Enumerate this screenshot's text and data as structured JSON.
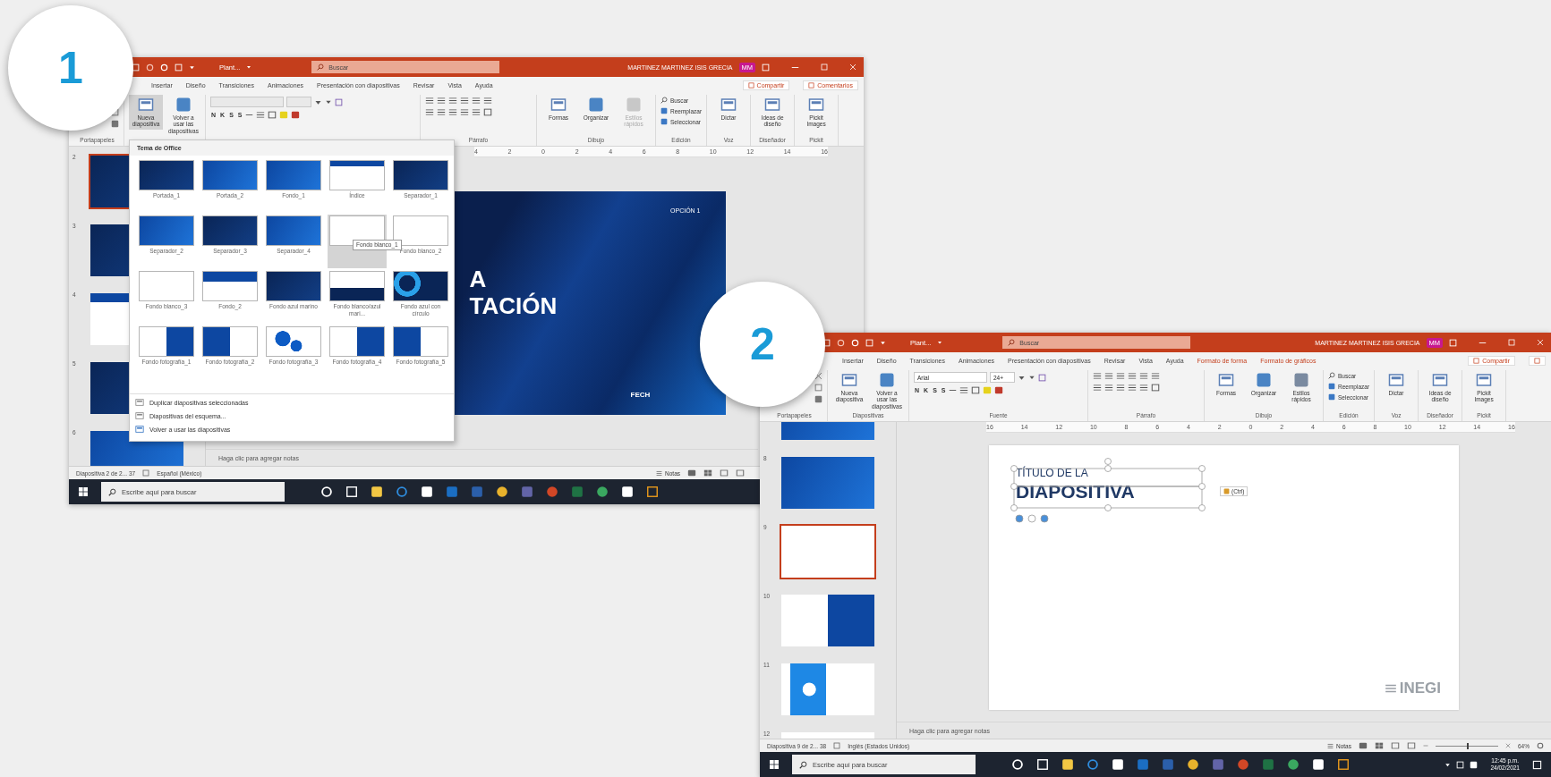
{
  "badges": [
    {
      "label": "1"
    },
    {
      "label": "2"
    }
  ],
  "windows": [
    {
      "title": "Plant...",
      "search_placeholder": "Buscar",
      "user": "MARTINEZ MARTINEZ ISIS GRECIA",
      "avatar": "MM",
      "tabs": [
        {
          "label": "Insertar",
          "kind": "standard"
        },
        {
          "label": "Diseño",
          "kind": "standard"
        },
        {
          "label": "Transiciones",
          "kind": "standard"
        },
        {
          "label": "Animaciones",
          "kind": "standard"
        },
        {
          "label": "Presentación con diapositivas",
          "kind": "standard"
        },
        {
          "label": "Revisar",
          "kind": "standard"
        },
        {
          "label": "Vista",
          "kind": "standard"
        },
        {
          "label": "Ayuda",
          "kind": "standard"
        }
      ],
      "share": "Compartir",
      "comments": "Comentarios",
      "ribbon": [
        {
          "kind": "clipboard",
          "label": "Portapapeles"
        },
        {
          "kind": "large",
          "buttons": [
            {
              "label": "Nueva diapositiva",
              "disabled": false,
              "pressed": true
            },
            {
              "label": "Volver a usar las diapositivas",
              "disabled": false,
              "pressed": false
            }
          ]
        },
        {
          "kind": "font",
          "format_keys": [
            "N",
            "K",
            "S",
            "S"
          ]
        },
        {
          "kind": "paragraph",
          "label": "Párrafo"
        },
        {
          "kind": "large",
          "label": "Dibujo",
          "buttons": [
            {
              "label": "Formas",
              "disabled": false,
              "pressed": false
            },
            {
              "label": "Organizar",
              "disabled": false,
              "pressed": false
            },
            {
              "label": "Estilos rápidos",
              "disabled": true,
              "pressed": false
            }
          ]
        },
        {
          "kind": "list",
          "label": "Edición",
          "buttons": [
            {
              "label": "Buscar"
            },
            {
              "label": "Reemplazar"
            },
            {
              "label": "Seleccionar"
            }
          ]
        },
        {
          "kind": "large",
          "label": "Voz",
          "buttons": [
            {
              "label": "Dictar",
              "disabled": false,
              "pressed": false
            }
          ]
        },
        {
          "kind": "large",
          "label": "Diseñador",
          "buttons": [
            {
              "label": "Ideas de diseño",
              "disabled": false,
              "pressed": false
            }
          ]
        },
        {
          "kind": "large",
          "label": "Pickit",
          "buttons": [
            {
              "label": "Pickit Images",
              "disabled": false,
              "pressed": false
            }
          ]
        }
      ],
      "ruler": [
        "4",
        "2",
        "0",
        "2",
        "4",
        "6",
        "8",
        "10",
        "12",
        "14",
        "16"
      ],
      "slides": [
        {
          "number": "2",
          "kind": "dark",
          "selected": true
        },
        {
          "number": "3",
          "kind": "dark",
          "selected": false
        },
        {
          "number": "4",
          "kind": "topline",
          "selected": false
        },
        {
          "number": "5",
          "kind": "dark",
          "selected": false
        },
        {
          "number": "6",
          "kind": "blue",
          "selected": false
        }
      ],
      "slide": {
        "kind": "dark",
        "texts": [
          {
            "kind": "tag",
            "text": "OPCIÓN 1"
          },
          {
            "kind": "title",
            "text": "A"
          },
          {
            "kind": "title",
            "text": "TACIÓN"
          },
          {
            "kind": "date",
            "text": "FECH"
          }
        ]
      },
      "notes": "Haga clic para agregar notas",
      "status": {
        "slide_info": "Diapositiva 2 de 2... 37",
        "language": "Español (México)",
        "notes": "Notas"
      },
      "taskbar": {
        "placeholder": "Escribe aquí para buscar"
      },
      "dropdown": {
        "header": "Tema de Office",
        "tooltip": "Fondo blanco_1",
        "layouts": [
          {
            "label": "Portada_1",
            "kind": "dark",
            "selected": false
          },
          {
            "label": "Portada_2",
            "kind": "blue",
            "selected": false
          },
          {
            "label": "Fondo_1",
            "kind": "blue",
            "selected": false
          },
          {
            "label": "Índice",
            "kind": "topline",
            "selected": false
          },
          {
            "label": "Separador_1",
            "kind": "dark",
            "selected": false
          },
          {
            "label": "Separador_2",
            "kind": "blue",
            "selected": false
          },
          {
            "label": "Separador_3",
            "kind": "dark",
            "selected": false
          },
          {
            "label": "Separador_4",
            "kind": "blue",
            "selected": false
          },
          {
            "kind": "white",
            "selected": true
          },
          {
            "label": "Fondo blanco_2",
            "kind": "white",
            "selected": false
          },
          {
            "label": "Fondo blanco_3",
            "kind": "white",
            "selected": false
          },
          {
            "label": "Fondo_2",
            "kind": "band",
            "selected": false
          },
          {
            "label": "Fondo azul marino",
            "kind": "dark",
            "selected": false
          },
          {
            "label": "Fondo blanco/azul mari...",
            "kind": "bottomband",
            "selected": false
          },
          {
            "label": "Fondo azul con círculo",
            "kind": "circle",
            "selected": false
          },
          {
            "label": "Fondo fotografía_1",
            "kind": "photo",
            "selected": false
          },
          {
            "label": "Fondo fotografía_2",
            "kind": "photoleft",
            "selected": false
          },
          {
            "label": "Fondo fotografía_3",
            "kind": "bubbles",
            "selected": false
          },
          {
            "label": "Fondo fotografía_4",
            "kind": "photo",
            "selected": false
          },
          {
            "label": "Fondo fotografía_5",
            "kind": "photoleft",
            "selected": false
          }
        ],
        "actions": [
          "Duplicar diapositivas seleccionadas",
          "Diapositivas del esquema...",
          "Volver a usar las diapositivas"
        ]
      }
    },
    {
      "title": "Plant...",
      "search_placeholder": "Buscar",
      "user": "MARTINEZ MARTINEZ ISIS GRECIA",
      "avatar": "MM",
      "tabs": [
        {
          "label": "Insertar",
          "kind": "standard"
        },
        {
          "label": "Diseño",
          "kind": "standard"
        },
        {
          "label": "Transiciones",
          "kind": "standard"
        },
        {
          "label": "Animaciones",
          "kind": "standard"
        },
        {
          "label": "Presentación con diapositivas",
          "kind": "standard"
        },
        {
          "label": "Revisar",
          "kind": "standard"
        },
        {
          "label": "Vista",
          "kind": "standard"
        },
        {
          "label": "Ayuda",
          "kind": "standard"
        },
        {
          "label": "Formato de forma",
          "kind": "context"
        },
        {
          "label": "Formato de gráficos",
          "kind": "context"
        }
      ],
      "share": "Compartir",
      "ribbon": [
        {
          "kind": "clipboard",
          "label": "Portapapeles"
        },
        {
          "kind": "large",
          "label": "Diapositivas",
          "buttons": [
            {
              "label": "Nueva diapositiva",
              "disabled": false,
              "pressed": false
            },
            {
              "label": "Volver a usar las diapositivas",
              "disabled": false,
              "pressed": false
            }
          ]
        },
        {
          "kind": "font",
          "label": "Fuente",
          "font_name": "Arial",
          "font_size": "24+",
          "format_keys": [
            "N",
            "K",
            "S",
            "S"
          ]
        },
        {
          "kind": "paragraph",
          "label": "Párrafo"
        },
        {
          "kind": "large",
          "label": "Dibujo",
          "buttons": [
            {
              "label": "Formas",
              "disabled": false,
              "pressed": false
            },
            {
              "label": "Organizar",
              "disabled": false,
              "pressed": false
            },
            {
              "label": "Estilos rápidos",
              "disabled": false,
              "pressed": false
            }
          ]
        },
        {
          "kind": "list",
          "label": "Edición",
          "buttons": [
            {
              "label": "Buscar"
            },
            {
              "label": "Reemplazar"
            },
            {
              "label": "Seleccionar"
            }
          ]
        },
        {
          "kind": "large",
          "label": "Voz",
          "buttons": [
            {
              "label": "Dictar",
              "disabled": false,
              "pressed": false
            }
          ]
        },
        {
          "kind": "large",
          "label": "Diseñador",
          "buttons": [
            {
              "label": "Ideas de diseño",
              "disabled": false,
              "pressed": false
            }
          ]
        },
        {
          "kind": "large",
          "label": "Pickit",
          "buttons": [
            {
              "label": "Pickit Images",
              "disabled": false,
              "pressed": false
            }
          ]
        }
      ],
      "ruler": [
        "16",
        "14",
        "12",
        "10",
        "8",
        "6",
        "4",
        "2",
        "0",
        "2",
        "4",
        "6",
        "8",
        "10",
        "12",
        "14",
        "16"
      ],
      "slides": [
        {
          "kind": "blue",
          "selected": false
        },
        {
          "number": "8",
          "kind": "blue",
          "selected": false
        },
        {
          "number": "9",
          "kind": "white",
          "selected": true
        },
        {
          "number": "10",
          "kind": "photo",
          "selected": false
        },
        {
          "number": "11",
          "kind": "diagram",
          "selected": false
        },
        {
          "number": "12",
          "kind": "white",
          "selected": false
        }
      ],
      "slide": {
        "kind": "white",
        "texts": [
          {
            "kind": "subtitle",
            "text": "TÍTULO DE LA"
          },
          {
            "kind": "heading",
            "text": "DIAPOSITIVA"
          },
          {
            "kind": "paste",
            "text": "(Ctrl)"
          },
          {
            "kind": "logo",
            "text": "INEGI"
          }
        ]
      },
      "notes": "Haga clic para agregar notas",
      "status": {
        "slide_info": "Diapositiva 9 de 2... 38",
        "language": "Inglés (Estados Unidos)",
        "notes": "Notas",
        "zoom": {
          "label": "64%",
          "level": 0.5
        }
      },
      "taskbar": {
        "placeholder": "Escribe aquí para buscar",
        "time": "12:45 p.m.",
        "date": "24/02/2021"
      }
    }
  ]
}
